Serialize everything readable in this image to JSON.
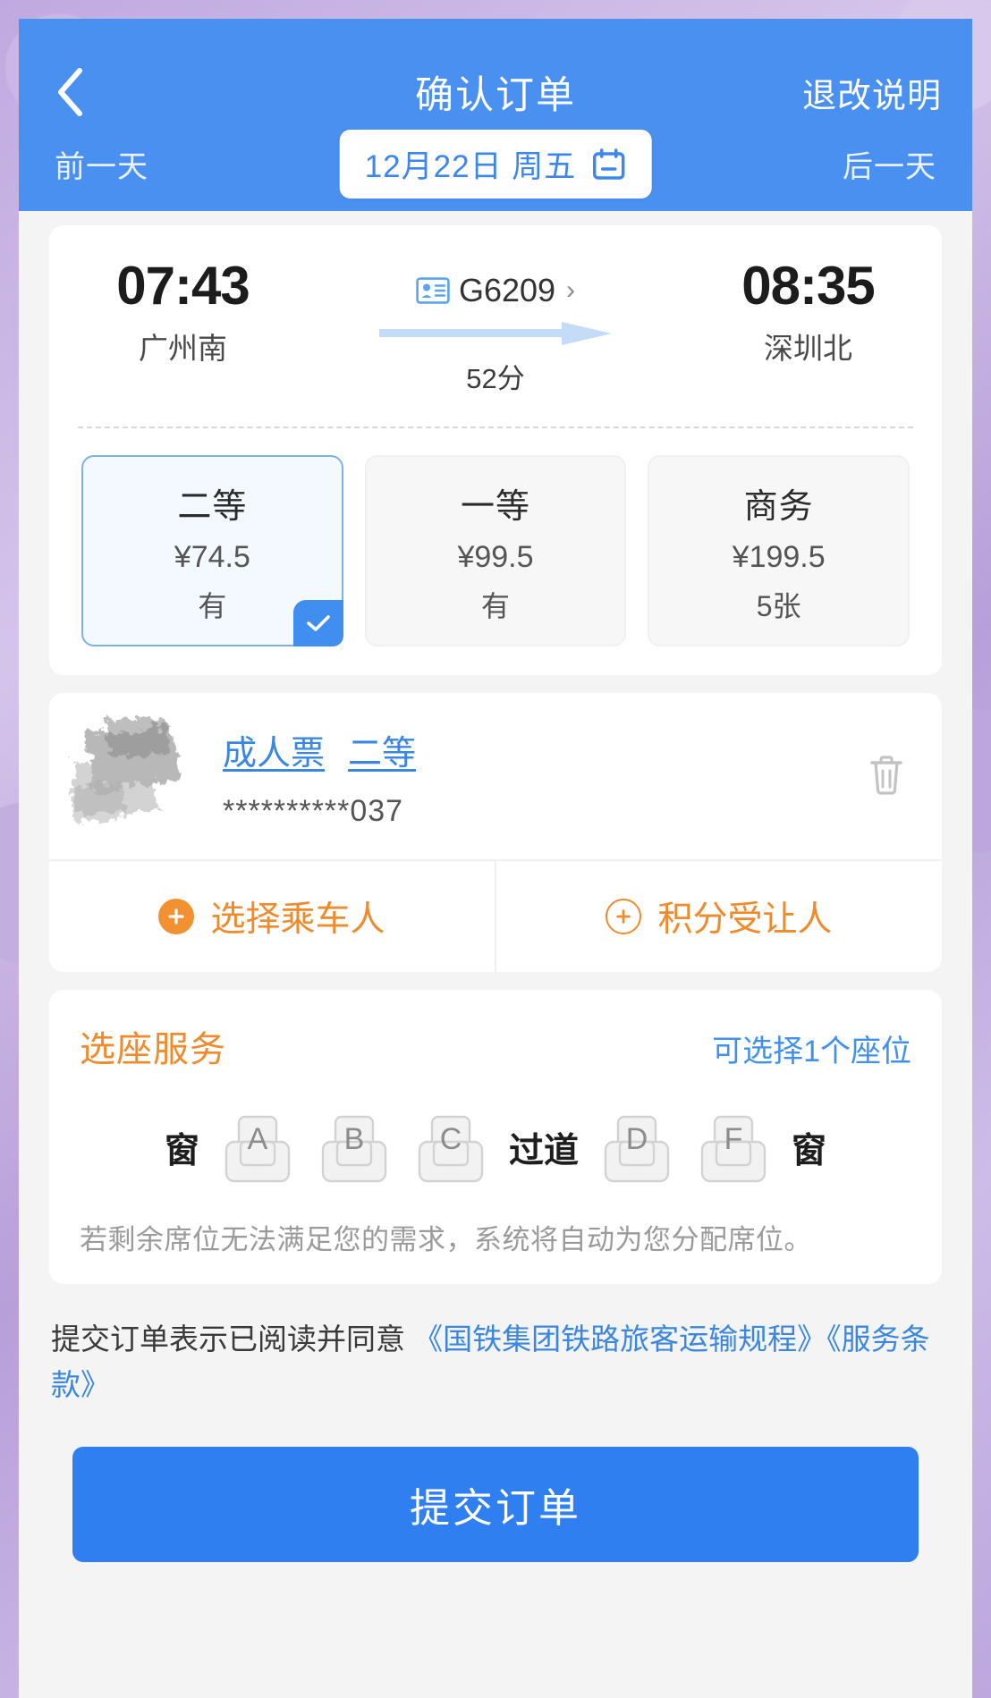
{
  "header": {
    "back_icon": "chevron-left-icon",
    "title": "确认订单",
    "right_action": "退改说明",
    "prev_day": "前一天",
    "next_day": "后一天",
    "date_label": "12月22日 周五",
    "calendar_icon": "calendar-icon",
    "bg_color": "#4a90f0"
  },
  "trip": {
    "depart_time": "07:43",
    "depart_station": "广州南",
    "arrive_time": "08:35",
    "arrive_station": "深圳北",
    "train_no": "G6209",
    "train_icon": "id-card-icon",
    "chevron": "›",
    "duration": "52分",
    "seat_classes": [
      {
        "name": "二等",
        "price": "¥74.5",
        "stock": "有",
        "selected": true
      },
      {
        "name": "一等",
        "price": "¥99.5",
        "stock": "有",
        "selected": false
      },
      {
        "name": "商务",
        "price": "¥199.5",
        "stock": "5张",
        "selected": false
      }
    ]
  },
  "passenger": {
    "ticket_type": "成人票",
    "seat_class": "二等",
    "id_number": "**********037",
    "delete_icon": "trash-icon",
    "actions": [
      {
        "label": "选择乘车人",
        "icon": "plus-circle-filled-icon"
      },
      {
        "label": "积分受让人",
        "icon": "plus-circle-outline-icon"
      }
    ]
  },
  "seat_service": {
    "title": "选座服务",
    "availability": "可选择1个座位",
    "window_left": "窗",
    "window_right": "窗",
    "aisle": "过道",
    "seats_left": [
      "A",
      "B",
      "C"
    ],
    "seats_right": [
      "D",
      "F"
    ],
    "note": "若剩余席位无法满足您的需求，系统将自动为您分配席位。"
  },
  "agreement": {
    "prefix": "提交订单表示已阅读并同意 ",
    "link1": "《国铁集团铁路旅客运输规程》",
    "link2": "《服务条款》"
  },
  "submit": {
    "label": "提交订单",
    "color": "#2f7ff0"
  }
}
